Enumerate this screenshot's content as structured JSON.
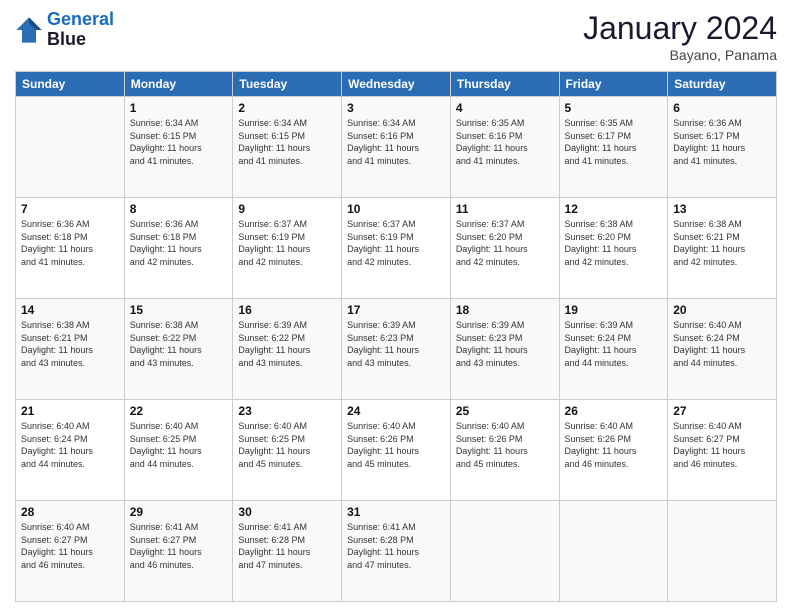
{
  "header": {
    "logo_line1": "General",
    "logo_line2": "Blue",
    "month_title": "January 2024",
    "location": "Bayano, Panama"
  },
  "columns": [
    "Sunday",
    "Monday",
    "Tuesday",
    "Wednesday",
    "Thursday",
    "Friday",
    "Saturday"
  ],
  "weeks": [
    [
      {
        "day": "",
        "info": ""
      },
      {
        "day": "1",
        "info": "Sunrise: 6:34 AM\nSunset: 6:15 PM\nDaylight: 11 hours\nand 41 minutes."
      },
      {
        "day": "2",
        "info": "Sunrise: 6:34 AM\nSunset: 6:15 PM\nDaylight: 11 hours\nand 41 minutes."
      },
      {
        "day": "3",
        "info": "Sunrise: 6:34 AM\nSunset: 6:16 PM\nDaylight: 11 hours\nand 41 minutes."
      },
      {
        "day": "4",
        "info": "Sunrise: 6:35 AM\nSunset: 6:16 PM\nDaylight: 11 hours\nand 41 minutes."
      },
      {
        "day": "5",
        "info": "Sunrise: 6:35 AM\nSunset: 6:17 PM\nDaylight: 11 hours\nand 41 minutes."
      },
      {
        "day": "6",
        "info": "Sunrise: 6:36 AM\nSunset: 6:17 PM\nDaylight: 11 hours\nand 41 minutes."
      }
    ],
    [
      {
        "day": "7",
        "info": "Sunrise: 6:36 AM\nSunset: 6:18 PM\nDaylight: 11 hours\nand 41 minutes."
      },
      {
        "day": "8",
        "info": "Sunrise: 6:36 AM\nSunset: 6:18 PM\nDaylight: 11 hours\nand 42 minutes."
      },
      {
        "day": "9",
        "info": "Sunrise: 6:37 AM\nSunset: 6:19 PM\nDaylight: 11 hours\nand 42 minutes."
      },
      {
        "day": "10",
        "info": "Sunrise: 6:37 AM\nSunset: 6:19 PM\nDaylight: 11 hours\nand 42 minutes."
      },
      {
        "day": "11",
        "info": "Sunrise: 6:37 AM\nSunset: 6:20 PM\nDaylight: 11 hours\nand 42 minutes."
      },
      {
        "day": "12",
        "info": "Sunrise: 6:38 AM\nSunset: 6:20 PM\nDaylight: 11 hours\nand 42 minutes."
      },
      {
        "day": "13",
        "info": "Sunrise: 6:38 AM\nSunset: 6:21 PM\nDaylight: 11 hours\nand 42 minutes."
      }
    ],
    [
      {
        "day": "14",
        "info": "Sunrise: 6:38 AM\nSunset: 6:21 PM\nDaylight: 11 hours\nand 43 minutes."
      },
      {
        "day": "15",
        "info": "Sunrise: 6:38 AM\nSunset: 6:22 PM\nDaylight: 11 hours\nand 43 minutes."
      },
      {
        "day": "16",
        "info": "Sunrise: 6:39 AM\nSunset: 6:22 PM\nDaylight: 11 hours\nand 43 minutes."
      },
      {
        "day": "17",
        "info": "Sunrise: 6:39 AM\nSunset: 6:23 PM\nDaylight: 11 hours\nand 43 minutes."
      },
      {
        "day": "18",
        "info": "Sunrise: 6:39 AM\nSunset: 6:23 PM\nDaylight: 11 hours\nand 43 minutes."
      },
      {
        "day": "19",
        "info": "Sunrise: 6:39 AM\nSunset: 6:24 PM\nDaylight: 11 hours\nand 44 minutes."
      },
      {
        "day": "20",
        "info": "Sunrise: 6:40 AM\nSunset: 6:24 PM\nDaylight: 11 hours\nand 44 minutes."
      }
    ],
    [
      {
        "day": "21",
        "info": "Sunrise: 6:40 AM\nSunset: 6:24 PM\nDaylight: 11 hours\nand 44 minutes."
      },
      {
        "day": "22",
        "info": "Sunrise: 6:40 AM\nSunset: 6:25 PM\nDaylight: 11 hours\nand 44 minutes."
      },
      {
        "day": "23",
        "info": "Sunrise: 6:40 AM\nSunset: 6:25 PM\nDaylight: 11 hours\nand 45 minutes."
      },
      {
        "day": "24",
        "info": "Sunrise: 6:40 AM\nSunset: 6:26 PM\nDaylight: 11 hours\nand 45 minutes."
      },
      {
        "day": "25",
        "info": "Sunrise: 6:40 AM\nSunset: 6:26 PM\nDaylight: 11 hours\nand 45 minutes."
      },
      {
        "day": "26",
        "info": "Sunrise: 6:40 AM\nSunset: 6:26 PM\nDaylight: 11 hours\nand 46 minutes."
      },
      {
        "day": "27",
        "info": "Sunrise: 6:40 AM\nSunset: 6:27 PM\nDaylight: 11 hours\nand 46 minutes."
      }
    ],
    [
      {
        "day": "28",
        "info": "Sunrise: 6:40 AM\nSunset: 6:27 PM\nDaylight: 11 hours\nand 46 minutes."
      },
      {
        "day": "29",
        "info": "Sunrise: 6:41 AM\nSunset: 6:27 PM\nDaylight: 11 hours\nand 46 minutes."
      },
      {
        "day": "30",
        "info": "Sunrise: 6:41 AM\nSunset: 6:28 PM\nDaylight: 11 hours\nand 47 minutes."
      },
      {
        "day": "31",
        "info": "Sunrise: 6:41 AM\nSunset: 6:28 PM\nDaylight: 11 hours\nand 47 minutes."
      },
      {
        "day": "",
        "info": ""
      },
      {
        "day": "",
        "info": ""
      },
      {
        "day": "",
        "info": ""
      }
    ]
  ]
}
